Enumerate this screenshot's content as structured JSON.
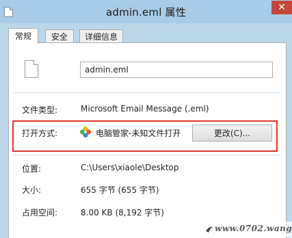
{
  "window": {
    "title": "admin.eml 属性",
    "close_glyph": "✕"
  },
  "tabs": [
    {
      "label": "常规",
      "active": true
    },
    {
      "label": "安全",
      "active": false
    },
    {
      "label": "详细信息",
      "active": false
    }
  ],
  "file": {
    "name": "admin.eml",
    "icon": "file-icon"
  },
  "fields": {
    "type_label": "文件类型:",
    "type_value": "Microsoft Email Message (.eml)",
    "open_with_label": "打开方式:",
    "open_with_value": "电脑管家-未知文件打开",
    "change_button": "更改(C)...",
    "location_label": "位置:",
    "location_value": "C:\\Users\\xiaole\\Desktop",
    "size_label": "大小:",
    "size_value": "655 字节 (655 字节)",
    "disk_label": "占用空间:",
    "disk_value": "8.00 KB (8,192 字节)"
  },
  "watermark": {
    "text": "www.0702.wang"
  },
  "colors": {
    "title_bar": "#a9cbe5",
    "close_button": "#c7453b",
    "highlight_border": "#d9362c"
  }
}
